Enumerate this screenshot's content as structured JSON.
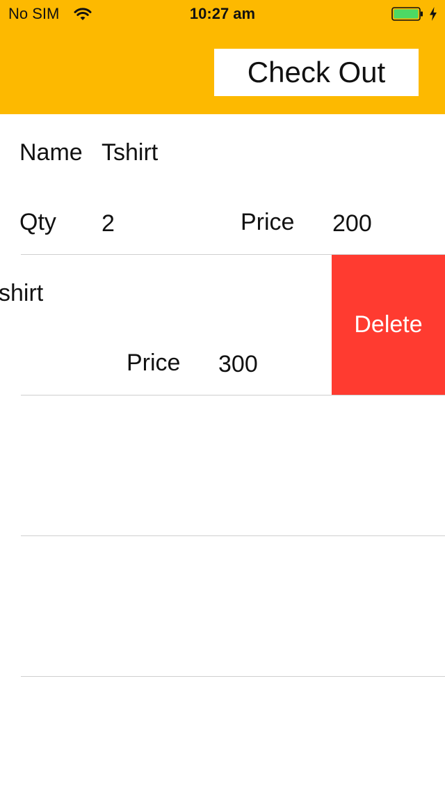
{
  "status_bar": {
    "carrier": "No SIM",
    "time": "10:27 am",
    "wifi_icon": "wifi-icon",
    "battery_icon": "battery-icon",
    "charging_icon": "charging-bolt-icon",
    "battery_color": "#4CD964"
  },
  "header": {
    "background": "#FDB900",
    "checkout_label": "Check Out"
  },
  "cart": {
    "labels": {
      "name": "Name",
      "qty": "Qty",
      "price": "Price"
    },
    "items": [
      {
        "name": "Tshirt",
        "qty": "2",
        "price": "200"
      },
      {
        "name": "Tshirt",
        "qty": "",
        "price": "300",
        "swiped": true
      }
    ],
    "swiped_name_fragment": "shirt",
    "delete_label": "Delete",
    "delete_color": "#FF3B30"
  }
}
